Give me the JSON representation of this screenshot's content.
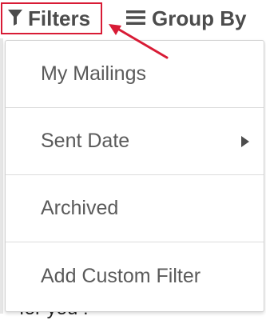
{
  "toolbar": {
    "filters_label": "Filters",
    "groupby_label": "Group By"
  },
  "menu": {
    "items": [
      {
        "label": "My Mailings"
      },
      {
        "label": "Sent Date"
      },
      {
        "label": "Archived"
      },
      {
        "label": "Add Custom Filter"
      }
    ]
  },
  "background": {
    "partial_text": "for you !"
  },
  "colors": {
    "highlight": "#d81b35",
    "text": "#4c4c4c",
    "menu_text": "#5a5a5a"
  },
  "icons": {
    "filters": "funnel-icon",
    "groupby": "bars-icon",
    "submenu": "caret-right-icon"
  }
}
